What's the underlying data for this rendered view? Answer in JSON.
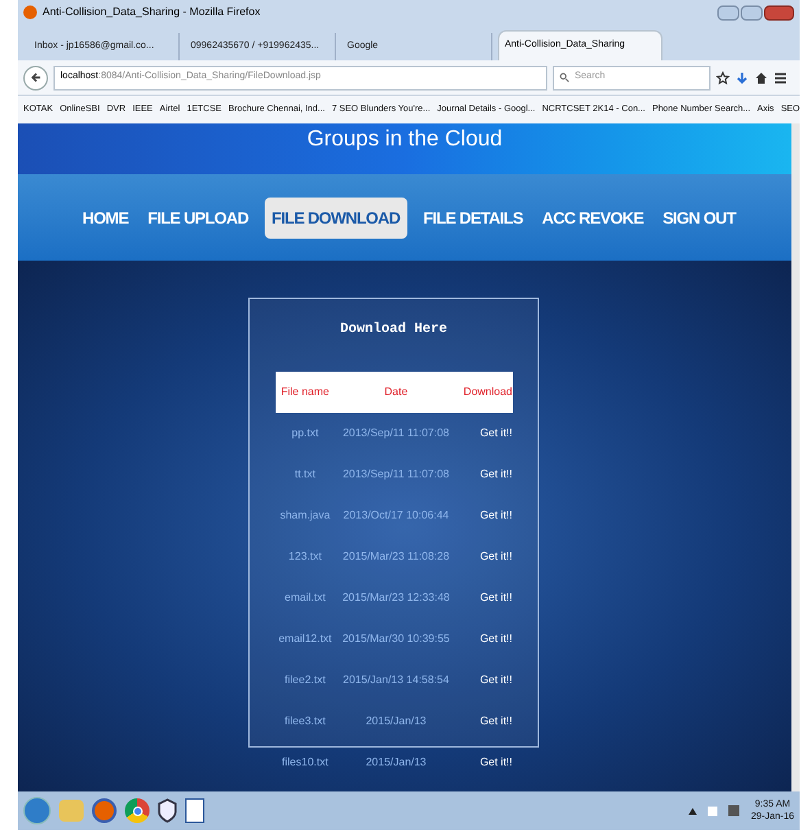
{
  "window": {
    "title": "Anti-Collision_Data_Sharing - Mozilla Firefox"
  },
  "tabs": [
    {
      "label": "Inbox - jp16586@gmail.co...",
      "selected": false
    },
    {
      "label": "09962435670 / +919962435...",
      "selected": false
    },
    {
      "label": "Google",
      "selected": false
    },
    {
      "label": "Anti-Collision_Data_Sharing",
      "selected": true
    }
  ],
  "address_bar": {
    "host": "localhost",
    "path": ":8084/Anti-Collision_Data_Sharing/FileDownload.jsp"
  },
  "search": {
    "placeholder": "Search"
  },
  "bookmarks": [
    "KOTAK",
    "OnlineSBI",
    "DVR",
    "IEEE",
    "Airtel",
    "1ETCSE",
    "Brochure Chennai, Ind...",
    "7 SEO Blunders You're...",
    "Journal Details - Googl...",
    "NCRTCSET 2K14 - Con...",
    "Phone Number Search...",
    "Axis",
    "SEO"
  ],
  "page": {
    "site_title": "Groups in the Cloud",
    "nav": [
      {
        "label": "HOME",
        "selected": false
      },
      {
        "label": "FILE UPLOAD",
        "selected": false
      },
      {
        "label": "FILE DOWNLOAD",
        "selected": true
      },
      {
        "label": "FILE DETAILS",
        "selected": false
      },
      {
        "label": "ACC REVOKE",
        "selected": false
      },
      {
        "label": "SIGN OUT",
        "selected": false
      }
    ],
    "panel_title": "Download Here",
    "table": {
      "columns": [
        "File name",
        "Date",
        "Download"
      ],
      "rows": [
        [
          "pp.txt",
          "2013/Sep/11 11:07:08",
          "Get it!!"
        ],
        [
          "tt.txt",
          "2013/Sep/11 11:07:08",
          "Get it!!"
        ],
        [
          "sham.java",
          "2013/Oct/17 10:06:44",
          "Get it!!"
        ],
        [
          "123.txt",
          "2015/Mar/23 11:08:28",
          "Get it!!"
        ],
        [
          "email.txt",
          "2015/Mar/23 12:33:48",
          "Get it!!"
        ],
        [
          "email12.txt",
          "2015/Mar/30 10:39:55",
          "Get it!!"
        ],
        [
          "filee2.txt",
          "2015/Jan/13 14:58:54",
          "Get it!!"
        ],
        [
          "filee3.txt",
          "2015/Jan/13",
          "Get it!!"
        ],
        [
          "files10.txt",
          "2015/Jan/13",
          "Get it!!"
        ]
      ]
    }
  },
  "taskbar": {
    "time": "9:35 AM",
    "date": "29-Jan-16"
  }
}
